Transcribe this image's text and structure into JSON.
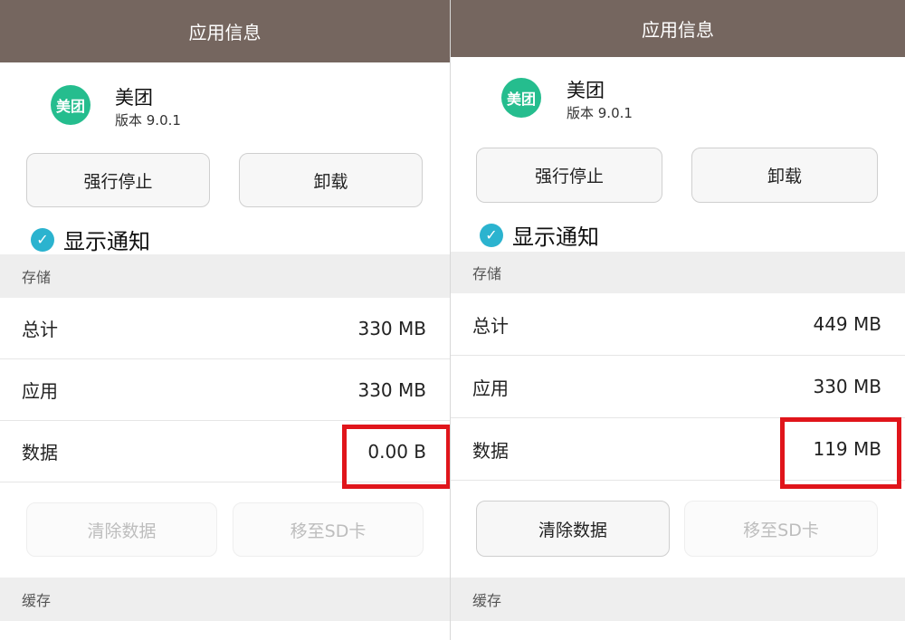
{
  "left": {
    "title": "应用信息",
    "app_icon_text": "美团",
    "app_name": "美团",
    "version": "版本 9.0.1",
    "force_stop_label": "强行停止",
    "uninstall_label": "卸载",
    "notify_label": "显示通知",
    "notify_checked": true,
    "storage_header": "存储",
    "rows": [
      {
        "label": "总计",
        "value": "330 MB"
      },
      {
        "label": "应用",
        "value": "330 MB"
      },
      {
        "label": "数据",
        "value": "0.00 B"
      }
    ],
    "clear_data_label": "清除数据",
    "clear_data_enabled": false,
    "move_sd_label": "移至SD卡",
    "move_sd_enabled": false,
    "cache_header": "缓存"
  },
  "right": {
    "title": "应用信息",
    "app_icon_text": "美团",
    "app_name": "美团",
    "version": "版本 9.0.1",
    "force_stop_label": "强行停止",
    "uninstall_label": "卸载",
    "notify_label": "显示通知",
    "notify_checked": true,
    "storage_header": "存储",
    "rows": [
      {
        "label": "总计",
        "value": "449 MB"
      },
      {
        "label": "应用",
        "value": "330 MB"
      },
      {
        "label": "数据",
        "value": "119 MB"
      }
    ],
    "clear_data_label": "清除数据",
    "clear_data_enabled": true,
    "move_sd_label": "移至SD卡",
    "move_sd_enabled": false,
    "cache_header": "缓存"
  },
  "colors": {
    "titlebar": "#75665f",
    "app_icon": "#25bd8e",
    "checkbox": "#2bb3cf",
    "highlight": "#e0151b"
  },
  "icons": {
    "check": "check-icon",
    "app": "meituan-app-icon"
  }
}
